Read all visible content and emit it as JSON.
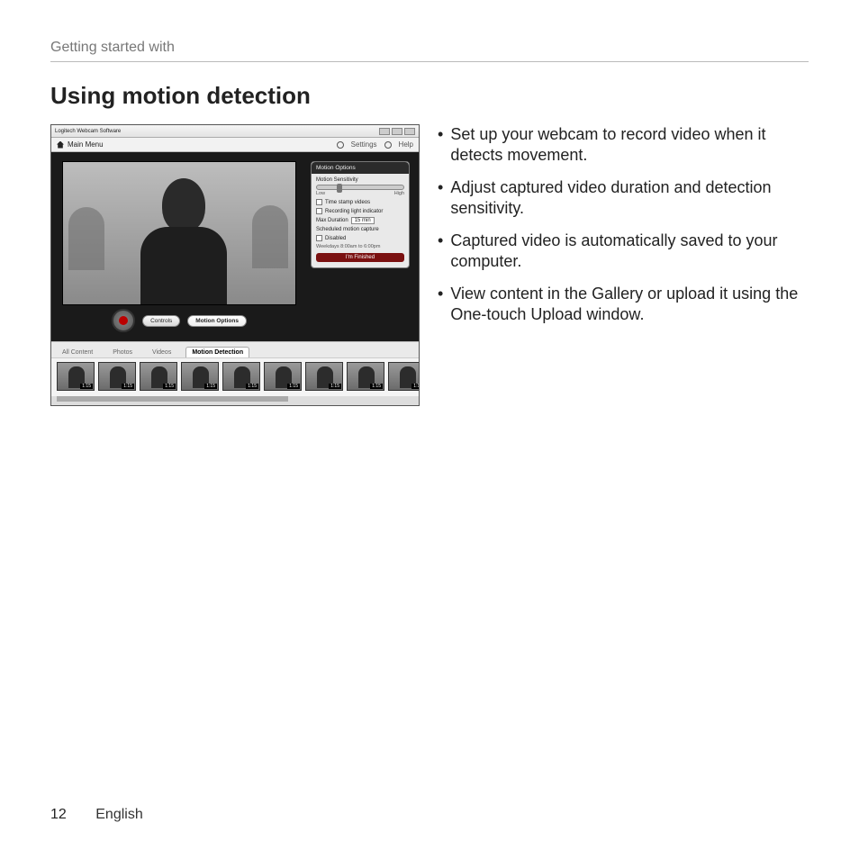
{
  "header": {
    "running": "Getting started with"
  },
  "heading": "Using motion detection",
  "bullets": [
    "Set up your webcam to record video when it detects movement.",
    "Adjust captured video duration and detection sensitivity.",
    "Captured video is automatically saved to your computer.",
    "View content in the Gallery or upload it using the One-touch Upload window."
  ],
  "footer": {
    "page": "12",
    "lang": "English"
  },
  "app": {
    "title": "Logitech Webcam Software",
    "menubar": {
      "main_menu": "Main Menu",
      "settings": "Settings",
      "help": "Help"
    },
    "viewer": {
      "controls_label": "Controls",
      "motion_options_label": "Motion Options"
    },
    "panel": {
      "title": "Motion Options",
      "sensitivity_label": "Motion Sensitivity",
      "low": "Low",
      "high": "High",
      "timestamp": "Time stamp videos",
      "lowlight": "Recording light indicator",
      "max_duration_label": "Max Duration",
      "max_duration_value": "15 min",
      "scheduled_label": "Scheduled motion capture",
      "disabled": "Disabled",
      "schedule_hint": "Weekdays 8:00am to 6:00pm",
      "apply": "I'm Finished"
    },
    "tabs": {
      "all": "All Content",
      "photos": "Photos",
      "videos": "Videos",
      "motion": "Motion Detection"
    },
    "thumb_time": "1:15"
  }
}
